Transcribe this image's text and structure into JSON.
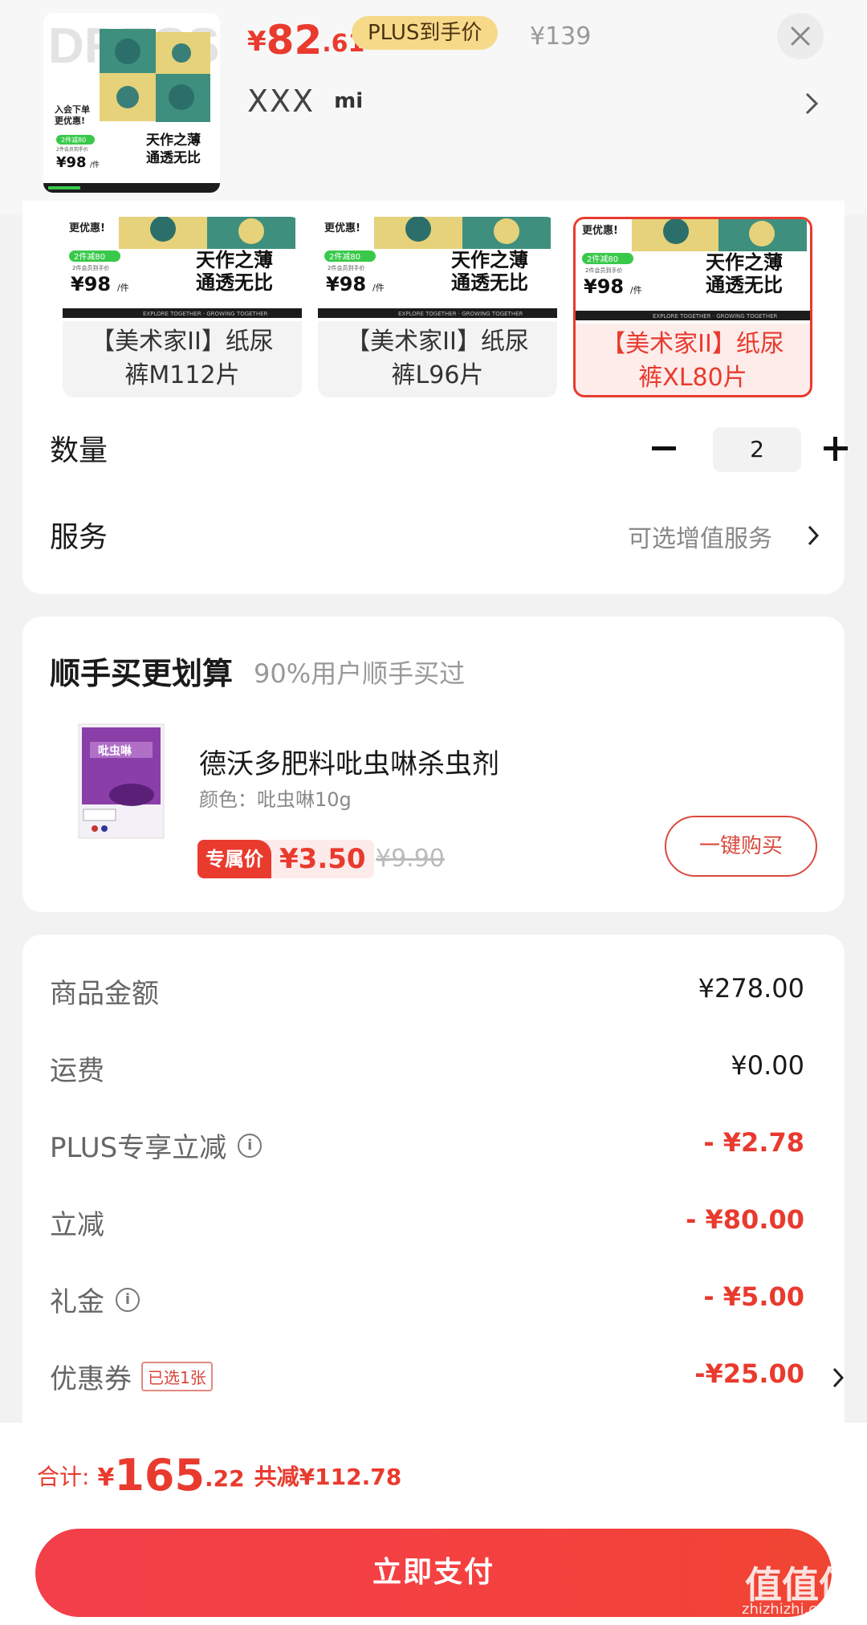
{
  "header": {
    "price_symbol": "¥",
    "price_int": "82",
    "price_dec": ".61",
    "plus_tag": "PLUS到手价",
    "orig_price": "¥139",
    "brand": "XXX",
    "mi_logo": "mi",
    "thumb": {
      "logo": "DRESS",
      "promo_a": "入会下单",
      "promo_b": "更优惠!",
      "badge": "2件减80",
      "badge_sub": "2件会员到手价",
      "price": "¥98",
      "price_unit": "/件",
      "slogan_a": "天作之薄",
      "slogan_b": "通透无比"
    }
  },
  "variants": [
    {
      "label_a": "【美术家II】纸尿",
      "label_b": "裤M112片"
    },
    {
      "label_a": "【美术家II】纸尿",
      "label_b": "裤L96片"
    },
    {
      "label_a": "【美术家II】纸尿",
      "label_b": "裤XL80片"
    }
  ],
  "variant_art": {
    "promo": "更优惠!",
    "badge": "2件减80",
    "badge_sub": "2件会员到手价",
    "price": "¥98",
    "price_unit": "/件",
    "slogan_a": "天作之薄",
    "slogan_b": "通透无比",
    "footer": "EXPLORE TOGETHER · GROWING TOGETHER"
  },
  "quantity": {
    "label": "数量",
    "value": "2",
    "minus": "−",
    "plus": "+"
  },
  "service": {
    "label": "服务",
    "hint": "可选增值服务"
  },
  "addon": {
    "title": "顺手买更划算",
    "subtitle": "90%用户顺手买过",
    "product_name": "德沃多肥料吡虫啉杀虫剂",
    "color": "颜色：吡虫啉10g",
    "exclusive_tag": "专属价",
    "price": "¥3.50",
    "orig_price": "¥9.90",
    "buy_button": "一键购买",
    "package_label": "吡虫啉"
  },
  "summary": {
    "goods_label": "商品金额",
    "goods_value": "¥278.00",
    "shipping_label": "运费",
    "shipping_value": "¥0.00",
    "plus_label": "PLUS专享立减",
    "plus_value": "- ¥2.78",
    "discount_label": "立减",
    "discount_value": "- ¥80.00",
    "gift_label": "礼金",
    "gift_value": "- ¥5.00",
    "coupon_label": "优惠券",
    "coupon_tag": "已选1张",
    "coupon_value": "-¥25.00"
  },
  "footer": {
    "total_label": "合计:",
    "total_symbol": "¥",
    "total_int": "165",
    "total_dec": ".22",
    "total_saved": "共减¥112.78",
    "pay_button": "立即支付",
    "watermark": "值值值",
    "watermark_url": "zhizhizhi.com"
  },
  "colors": {
    "accent": "#e93a2e",
    "plus_tag": "#f7d98a",
    "green_badge": "#39c94a"
  }
}
